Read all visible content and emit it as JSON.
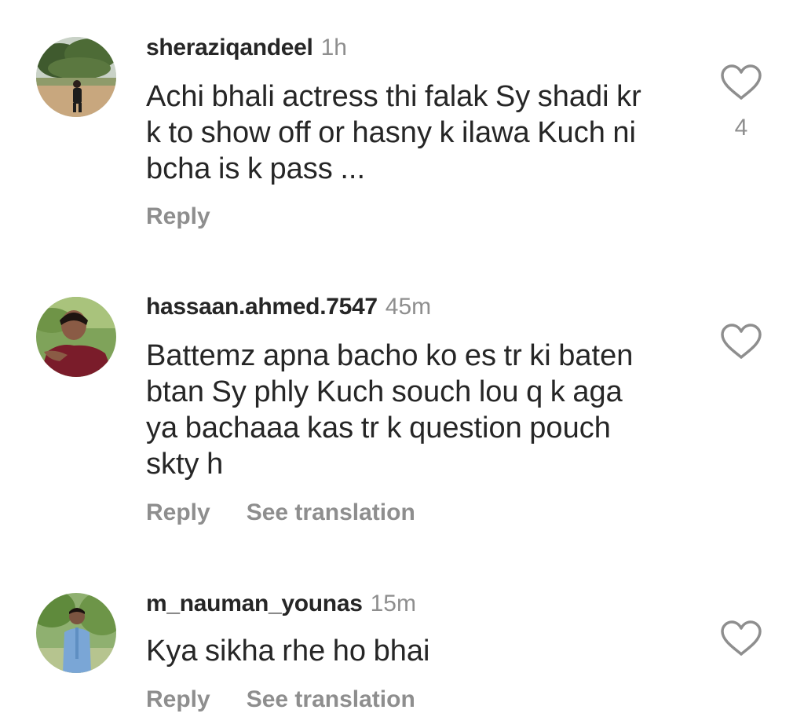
{
  "comments": [
    {
      "username": "sheraziqandeel",
      "time": "1h",
      "lines": [
        "Achi bhali actress thi falak Sy shadi kr",
        "k to show off or hasny k ilawa Kuch ni",
        "bcha is k pass ..."
      ],
      "reply_label": "Reply",
      "like_count": "4",
      "avatar_icon": "user-avatar-photo"
    },
    {
      "username": "hassaan.ahmed.7547",
      "time": "45m",
      "lines": [
        "Battemz apna bacho ko es tr ki baten",
        "btan Sy phly Kuch souch lou q k aga",
        "ya bachaaa kas tr k question pouch",
        "skty h"
      ],
      "reply_label": "Reply",
      "translation_label": "See translation",
      "avatar_icon": "user-avatar-photo"
    },
    {
      "username": "m_nauman_younas",
      "time": "15m",
      "lines": [
        "Kya sikha rhe ho bhai"
      ],
      "reply_label": "Reply",
      "translation_label": "See translation",
      "avatar_icon": "user-avatar-photo"
    }
  ],
  "colors": {
    "text": "#262626",
    "secondary": "#8e8e8e",
    "background": "#ffffff"
  },
  "icons": {
    "like": "heart-outline-icon"
  }
}
